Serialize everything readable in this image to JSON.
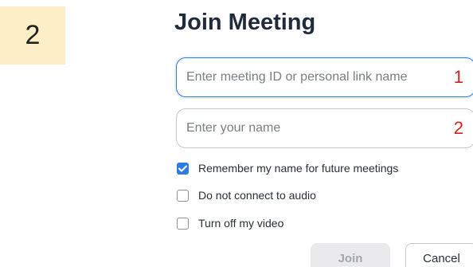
{
  "step_badge": "2",
  "dialog": {
    "title": "Join Meeting",
    "meeting_id": {
      "value": "",
      "placeholder": "Enter meeting ID or personal link name",
      "marker": "1"
    },
    "name": {
      "value": "",
      "placeholder": "Enter your name",
      "marker": "2"
    },
    "options": [
      {
        "label": "Remember my name for future meetings",
        "checked": true
      },
      {
        "label": "Do not connect to audio",
        "checked": false
      },
      {
        "label": "Turn off my video",
        "checked": false
      }
    ],
    "buttons": {
      "join": "Join",
      "cancel": "Cancel"
    }
  },
  "colors": {
    "badge_bg": "#fcefc8",
    "accent": "#2d7de0",
    "marker": "#d2231c"
  }
}
